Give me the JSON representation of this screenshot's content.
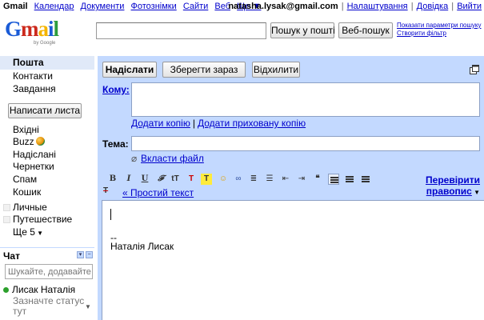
{
  "topbar": {
    "app_name": "Gmail",
    "links": [
      "Календар",
      "Документи",
      "Фотознімки",
      "Сайти",
      "Веб"
    ],
    "more": "Ще ▼",
    "email": "natasha.lysak@gmail.com",
    "right_links": [
      "Налаштування",
      "Довідка",
      "Вийти"
    ],
    "separator": "|"
  },
  "logo": {
    "word": "Gmail",
    "byline": "by Google"
  },
  "search": {
    "value": "",
    "search_mail_label": "Пошук у пошті",
    "web_search_label": "Веб-пошук",
    "show_options": "Показати параметри пошуку",
    "create_filter": "Створити фільтр"
  },
  "sidebar": {
    "top_items": [
      {
        "label": "Пошта",
        "selected": true
      },
      {
        "label": "Контакти"
      },
      {
        "label": "Завдання"
      }
    ],
    "compose_label": "Написати листа",
    "folders": [
      {
        "label": "Вхідні"
      },
      {
        "label": "Buzz",
        "icon": "buzz-icon"
      },
      {
        "label": "Надіслані"
      },
      {
        "label": "Чернетки"
      },
      {
        "label": "Спам"
      },
      {
        "label": "Кошик"
      }
    ],
    "labels": [
      {
        "label": "Личные"
      },
      {
        "label": "Путешествие"
      }
    ],
    "more_label": "Ще 5"
  },
  "chat": {
    "title": "Чат",
    "search_placeholder": "Шукайте, додавайте",
    "user_name": "Лисак Наталія",
    "status_prompt": "Зазначте статус тут",
    "status_color": "#2ca02c"
  },
  "compose": {
    "send_label": "Надіслати",
    "save_label": "Зберегти зараз",
    "discard_label": "Відхилити",
    "to_label": "Кому:",
    "add_cc": "Додати копію",
    "add_bcc": "Додати приховану копію",
    "subject_label": "Тема:",
    "attach_label": "Вкласти файл",
    "plain_text_label": "« Простий текст",
    "spellcheck_label": "Перевірити правопис",
    "signature_dashes": "--",
    "signature_name": "Наталія Лисак"
  },
  "colors": {
    "accent_panel": "#c3d9ff",
    "link": "#0000cc",
    "selected_nav": "#e0e9f8"
  }
}
